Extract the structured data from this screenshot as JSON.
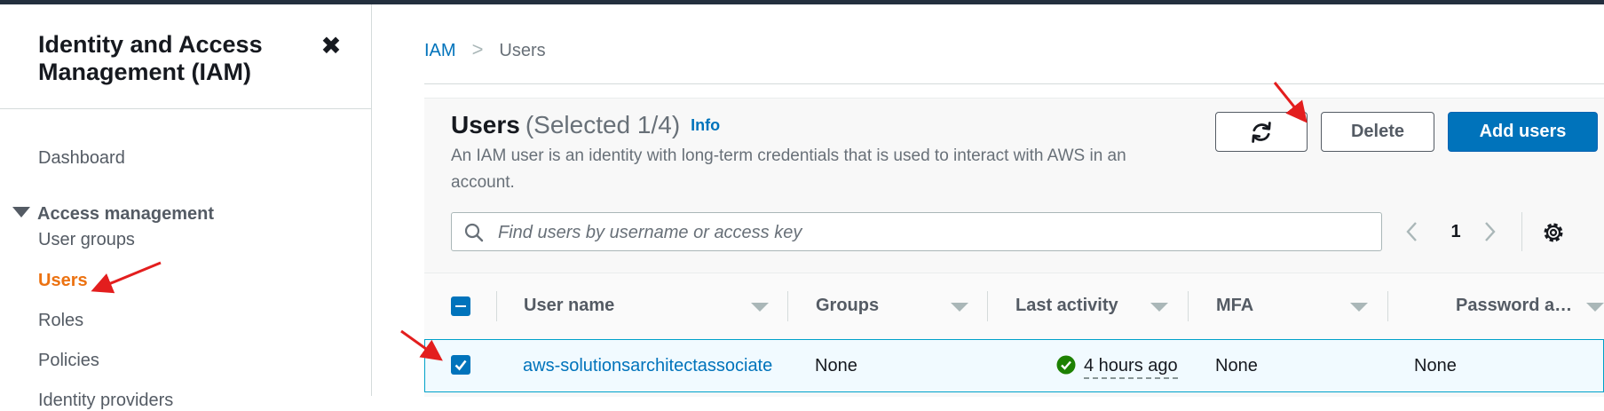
{
  "sidebar": {
    "title": "Identity and Access Management (IAM)",
    "close_icon": "close-icon",
    "items": {
      "dashboard": "Dashboard",
      "section_access_management": "Access management",
      "user_groups": "User groups",
      "users": "Users",
      "roles": "Roles",
      "policies": "Policies",
      "identity_providers": "Identity providers"
    }
  },
  "breadcrumb": {
    "root": "IAM",
    "separator": ">",
    "current": "Users"
  },
  "users_panel": {
    "title": "Users",
    "selected_count": "(Selected 1/4)",
    "info_link": "Info",
    "description": "An IAM user is an identity with long-term credentials that is used to interact with AWS in an account.",
    "refresh_icon": "refresh-icon",
    "delete_label": "Delete",
    "add_users_label": "Add users",
    "search": {
      "placeholder": "Find users by username or access key",
      "value": ""
    },
    "pagination": {
      "current_page": "1"
    },
    "settings_icon": "gear-icon"
  },
  "table": {
    "columns": [
      "User name",
      "Groups",
      "Last activity",
      "MFA",
      "Password a…"
    ],
    "rows": [
      {
        "selected": true,
        "user_name": "aws-solutionsarchitectassociate",
        "groups": "None",
        "last_activity": "4 hours ago",
        "mfa": "None",
        "password_age": "None"
      }
    ]
  },
  "colors": {
    "accent": "#0073bb",
    "active_nav": "#ec7211",
    "primary_button": "#0073bb",
    "success": "#1d8102",
    "annotation_arrow": "#e31e1e"
  }
}
